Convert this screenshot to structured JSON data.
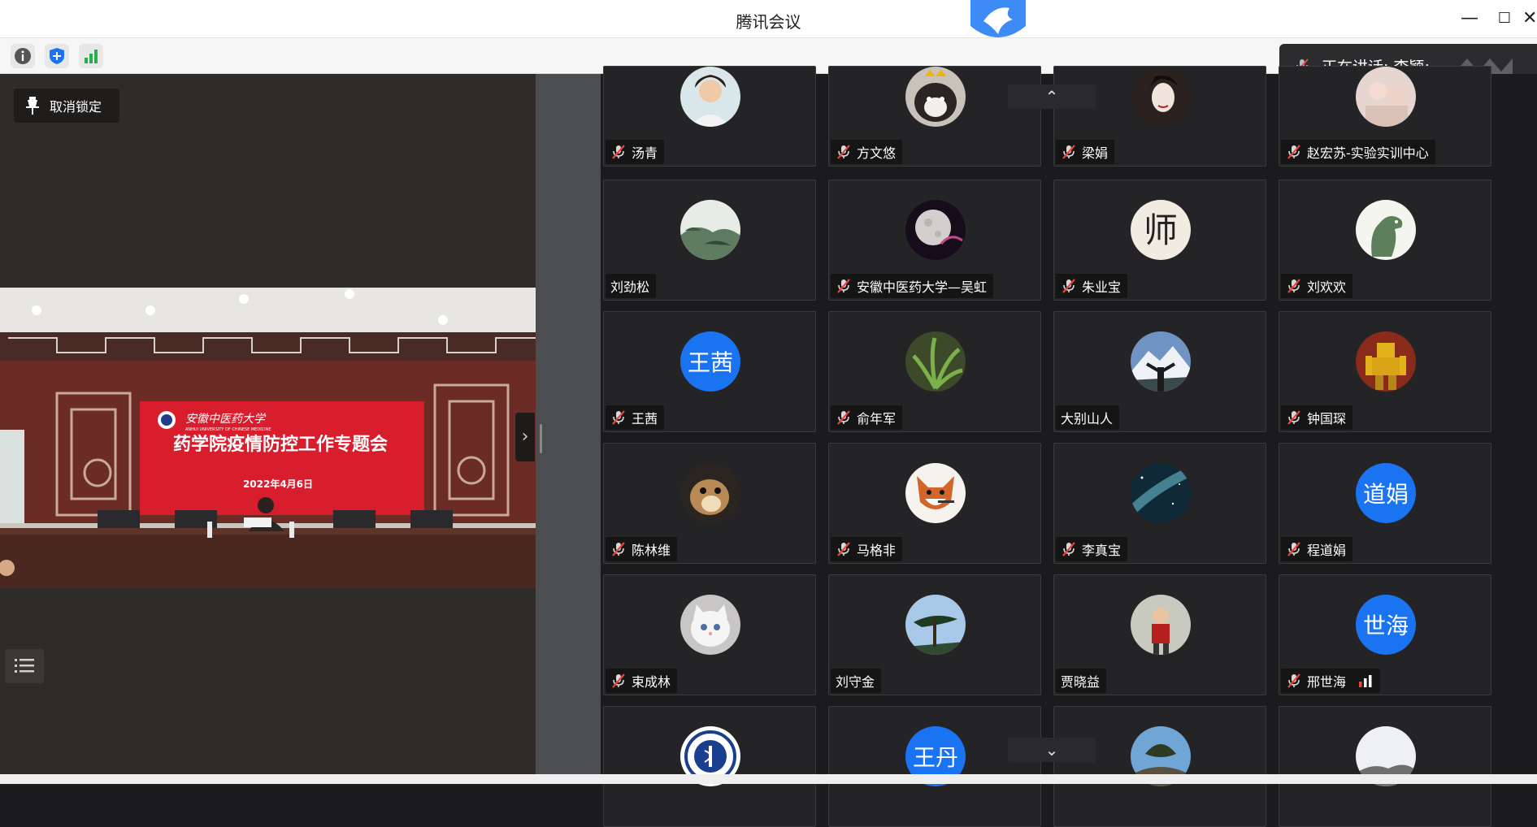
{
  "window": {
    "title": "腾讯会议",
    "minimize": "—",
    "maximize": "☐",
    "close": "✕"
  },
  "speaking": {
    "label": "正在讲话: 李颖;"
  },
  "left": {
    "unlock_label": "取消锁定"
  },
  "video": {
    "banner_title": "药学院疫情防控工作专题会",
    "banner_date": "2022年4月6日",
    "banner_school": "安徽中医药大学",
    "banner_school_en": "ANHUI UNIVERSITY OF CHINESE MEDICINE"
  },
  "participants": [
    {
      "name": "汤青",
      "muted": true,
      "avatar": "photo-woman"
    },
    {
      "name": "方文悠",
      "muted": true,
      "avatar": "photo-dog"
    },
    {
      "name": "梁娟",
      "muted": true,
      "avatar": "photo-portrait"
    },
    {
      "name": "赵宏苏-实验实训中心",
      "muted": true,
      "avatar": "photo-baby"
    },
    {
      "name": "刘劲松",
      "muted": false,
      "avatar": "photo-landscape"
    },
    {
      "name": "安徽中医药大学—吴虹",
      "muted": true,
      "avatar": "photo-moon"
    },
    {
      "name": "朱业宝",
      "muted": true,
      "avatar": "photo-calligraphy",
      "avatar_char": "师"
    },
    {
      "name": "刘欢欢",
      "muted": true,
      "avatar": "photo-dinosaur"
    },
    {
      "name": "王茜",
      "muted": true,
      "avatar_text": "王茜"
    },
    {
      "name": "俞年军",
      "muted": true,
      "avatar": "photo-plant"
    },
    {
      "name": "大别山人",
      "muted": false,
      "avatar": "photo-mountain"
    },
    {
      "name": "钟国琛",
      "muted": true,
      "avatar": "photo-robot"
    },
    {
      "name": "陈林维",
      "muted": true,
      "avatar": "photo-squirrel"
    },
    {
      "name": "马格非",
      "muted": true,
      "avatar": "photo-fox"
    },
    {
      "name": "李真宝",
      "muted": true,
      "avatar": "photo-galaxy"
    },
    {
      "name": "程道娟",
      "muted": true,
      "avatar_text": "道娟"
    },
    {
      "name": "束成林",
      "muted": true,
      "avatar": "photo-cat"
    },
    {
      "name": "刘守金",
      "muted": false,
      "avatar": "photo-pine"
    },
    {
      "name": "贾晓益",
      "muted": false,
      "avatar": "photo-child"
    },
    {
      "name": "邢世海",
      "muted": true,
      "avatar_text": "世海",
      "signal": true
    },
    {
      "name": "",
      "muted": true,
      "avatar": "photo-emblem"
    },
    {
      "name": "",
      "muted": true,
      "avatar_text": "王丹"
    },
    {
      "name": "",
      "muted": true,
      "avatar": "photo-tree"
    },
    {
      "name": "",
      "muted": true,
      "avatar": "photo-sky"
    }
  ],
  "colors": {
    "accent_blue": "#1a73f0",
    "mic_red": "#e8453c",
    "signal_green": "#22b14c",
    "signal_red": "#e8453c"
  }
}
